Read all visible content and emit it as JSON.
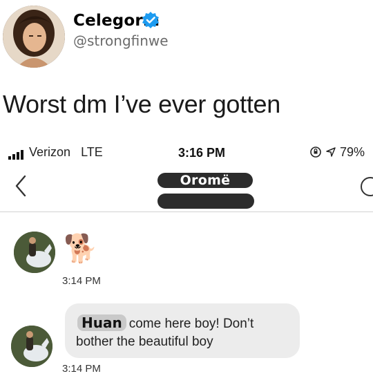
{
  "tweet": {
    "display_name": "Celegorm",
    "handle": "@strongfinwe",
    "verified": true,
    "text": "Worst dm I’ve ever gotten"
  },
  "screenshot": {
    "status_bar": {
      "carrier": "Verizon",
      "network": "LTE",
      "time": "3:16 PM",
      "battery": "79%"
    },
    "header": {
      "contact_name": "Oromë"
    },
    "messages": [
      {
        "content": "🐕",
        "time": "3:14 PM"
      },
      {
        "name_tag": "Huan",
        "text_line1": "come here boy! Don’t",
        "text_line2": "bother the beautiful boy",
        "time": "3:14 PM"
      }
    ]
  },
  "colors": {
    "verified_badge": "#1d9bf0",
    "bubble": "#ececec",
    "redaction": "#2c2c2c"
  }
}
